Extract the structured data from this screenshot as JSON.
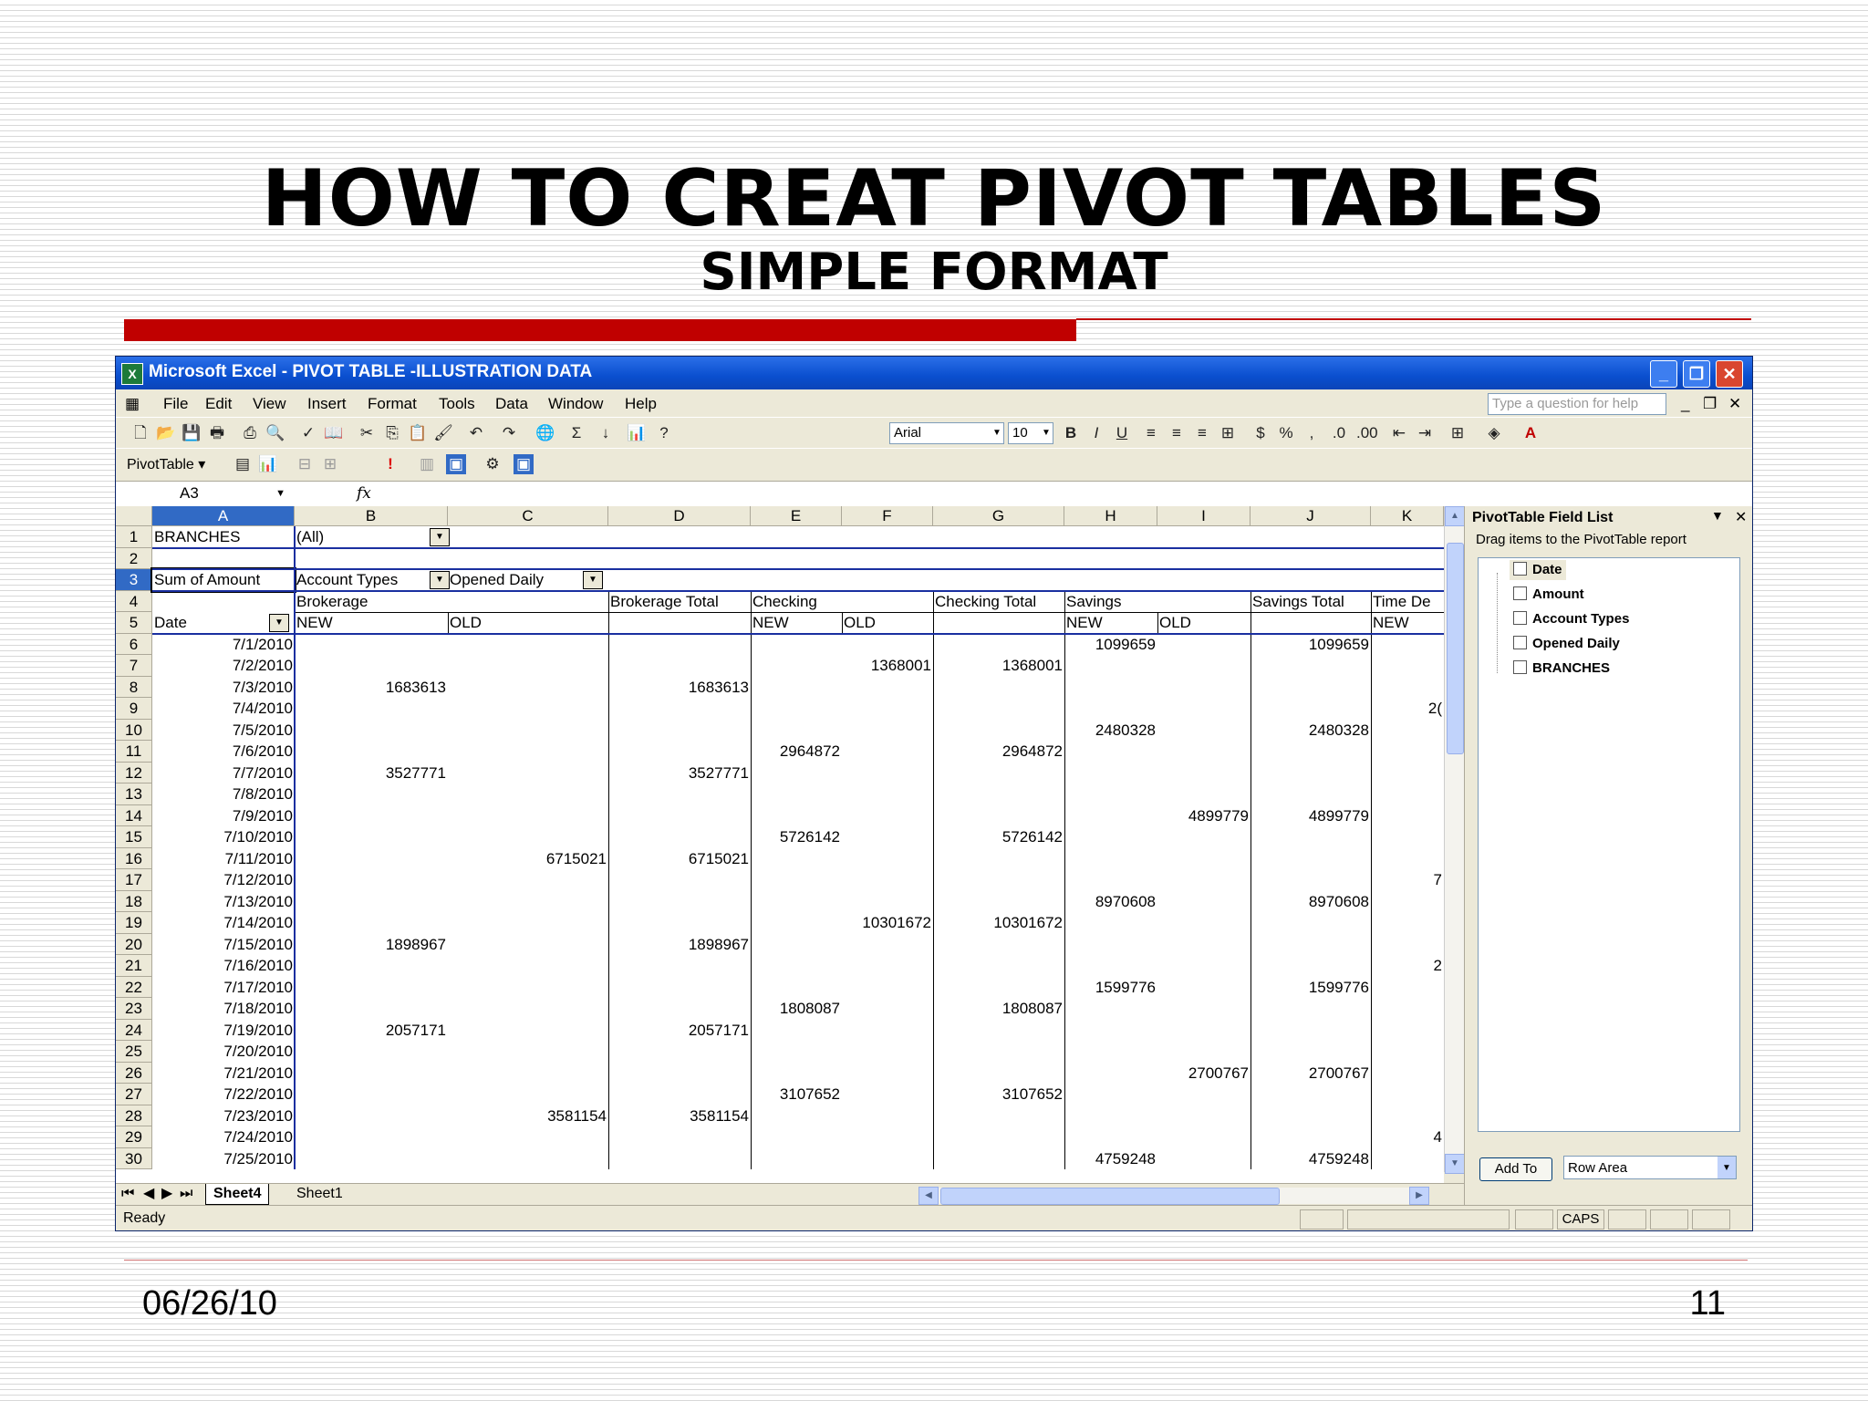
{
  "slide": {
    "title": "HOW TO CREAT PIVOT TABLES",
    "subtitle": "SIMPLE FORMAT",
    "date": "06/26/10",
    "page_number": "11"
  },
  "window": {
    "title": "Microsoft Excel - PIVOT TABLE -ILLUSTRATION DATA",
    "menu": [
      "File",
      "Edit",
      "View",
      "Insert",
      "Format",
      "Tools",
      "Data",
      "Window",
      "Help"
    ],
    "ask_placeholder": "Type a question for help",
    "font_name": "Arial",
    "font_size": "10",
    "pivot_toolbar_label": "PivotTable ▾",
    "name_box": "A3",
    "fx": "fx"
  },
  "grid": {
    "columns": [
      "A",
      "B",
      "C",
      "D",
      "E",
      "F",
      "G",
      "H",
      "I",
      "J",
      "K"
    ],
    "rows": [
      "1",
      "2",
      "3",
      "4",
      "5",
      "6",
      "7",
      "8",
      "9",
      "10",
      "11",
      "12",
      "13",
      "14",
      "15",
      "16",
      "17",
      "18",
      "19",
      "20",
      "21",
      "22",
      "23",
      "24",
      "25",
      "26",
      "27",
      "28",
      "29",
      "30"
    ],
    "header": {
      "branches_label": "BRANCHES",
      "branches_value": "(All)",
      "sum_label": "Sum of Amount",
      "account_types": "Account Types",
      "opened_daily": "Opened Daily",
      "brokerage": "Brokerage",
      "brokerage_total": "Brokerage Total",
      "checking": "Checking",
      "checking_total": "Checking Total",
      "savings": "Savings",
      "savings_total": "Savings Total",
      "time_de": "Time De",
      "date": "Date",
      "new": "NEW",
      "old": "OLD"
    },
    "data_rows": [
      {
        "date": "7/1/2010",
        "b": "",
        "c": "",
        "d": "",
        "e": "",
        "f": "",
        "g": "",
        "h": "1099659",
        "i": "",
        "j": "1099659",
        "k": ""
      },
      {
        "date": "7/2/2010",
        "b": "",
        "c": "",
        "d": "",
        "e": "",
        "f": "1368001",
        "g": "1368001",
        "h": "",
        "i": "",
        "j": "",
        "k": ""
      },
      {
        "date": "7/3/2010",
        "b": "1683613",
        "c": "",
        "d": "1683613",
        "e": "",
        "f": "",
        "g": "",
        "h": "",
        "i": "",
        "j": "",
        "k": ""
      },
      {
        "date": "7/4/2010",
        "b": "",
        "c": "",
        "d": "",
        "e": "",
        "f": "",
        "g": "",
        "h": "",
        "i": "",
        "j": "",
        "k": "2("
      },
      {
        "date": "7/5/2010",
        "b": "",
        "c": "",
        "d": "",
        "e": "",
        "f": "",
        "g": "",
        "h": "2480328",
        "i": "",
        "j": "2480328",
        "k": ""
      },
      {
        "date": "7/6/2010",
        "b": "",
        "c": "",
        "d": "",
        "e": "2964872",
        "f": "",
        "g": "2964872",
        "h": "",
        "i": "",
        "j": "",
        "k": ""
      },
      {
        "date": "7/7/2010",
        "b": "3527771",
        "c": "",
        "d": "3527771",
        "e": "",
        "f": "",
        "g": "",
        "h": "",
        "i": "",
        "j": "",
        "k": ""
      },
      {
        "date": "7/8/2010",
        "b": "",
        "c": "",
        "d": "",
        "e": "",
        "f": "",
        "g": "",
        "h": "",
        "i": "",
        "j": "",
        "k": ""
      },
      {
        "date": "7/9/2010",
        "b": "",
        "c": "",
        "d": "",
        "e": "",
        "f": "",
        "g": "",
        "h": "",
        "i": "4899779",
        "j": "4899779",
        "k": ""
      },
      {
        "date": "7/10/2010",
        "b": "",
        "c": "",
        "d": "",
        "e": "5726142",
        "f": "",
        "g": "5726142",
        "h": "",
        "i": "",
        "j": "",
        "k": ""
      },
      {
        "date": "7/11/2010",
        "b": "",
        "c": "6715021",
        "d": "6715021",
        "e": "",
        "f": "",
        "g": "",
        "h": "",
        "i": "",
        "j": "",
        "k": ""
      },
      {
        "date": "7/12/2010",
        "b": "",
        "c": "",
        "d": "",
        "e": "",
        "f": "",
        "g": "",
        "h": "",
        "i": "",
        "j": "",
        "k": "7"
      },
      {
        "date": "7/13/2010",
        "b": "",
        "c": "",
        "d": "",
        "e": "",
        "f": "",
        "g": "",
        "h": "8970608",
        "i": "",
        "j": "8970608",
        "k": ""
      },
      {
        "date": "7/14/2010",
        "b": "",
        "c": "",
        "d": "",
        "e": "",
        "f": "10301672",
        "g": "10301672",
        "h": "",
        "i": "",
        "j": "",
        "k": ""
      },
      {
        "date": "7/15/2010",
        "b": "1898967",
        "c": "",
        "d": "1898967",
        "e": "",
        "f": "",
        "g": "",
        "h": "",
        "i": "",
        "j": "",
        "k": ""
      },
      {
        "date": "7/16/2010",
        "b": "",
        "c": "",
        "d": "",
        "e": "",
        "f": "",
        "g": "",
        "h": "",
        "i": "",
        "j": "",
        "k": "2"
      },
      {
        "date": "7/17/2010",
        "b": "",
        "c": "",
        "d": "",
        "e": "",
        "f": "",
        "g": "",
        "h": "1599776",
        "i": "",
        "j": "1599776",
        "k": ""
      },
      {
        "date": "7/18/2010",
        "b": "",
        "c": "",
        "d": "",
        "e": "1808087",
        "f": "",
        "g": "1808087",
        "h": "",
        "i": "",
        "j": "",
        "k": ""
      },
      {
        "date": "7/19/2010",
        "b": "2057171",
        "c": "",
        "d": "2057171",
        "e": "",
        "f": "",
        "g": "",
        "h": "",
        "i": "",
        "j": "",
        "k": ""
      },
      {
        "date": "7/20/2010",
        "b": "",
        "c": "",
        "d": "",
        "e": "",
        "f": "",
        "g": "",
        "h": "",
        "i": "",
        "j": "",
        "k": ""
      },
      {
        "date": "7/21/2010",
        "b": "",
        "c": "",
        "d": "",
        "e": "",
        "f": "",
        "g": "",
        "h": "",
        "i": "2700767",
        "j": "2700767",
        "k": ""
      },
      {
        "date": "7/22/2010",
        "b": "",
        "c": "",
        "d": "",
        "e": "3107652",
        "f": "",
        "g": "3107652",
        "h": "",
        "i": "",
        "j": "",
        "k": ""
      },
      {
        "date": "7/23/2010",
        "b": "",
        "c": "3581154",
        "d": "3581154",
        "e": "",
        "f": "",
        "g": "",
        "h": "",
        "i": "",
        "j": "",
        "k": ""
      },
      {
        "date": "7/24/2010",
        "b": "",
        "c": "",
        "d": "",
        "e": "",
        "f": "",
        "g": "",
        "h": "",
        "i": "",
        "j": "",
        "k": "4"
      },
      {
        "date": "7/25/2010",
        "b": "",
        "c": "",
        "d": "",
        "e": "",
        "f": "",
        "g": "",
        "h": "4759248",
        "i": "",
        "j": "4759248",
        "k": ""
      }
    ]
  },
  "sheets": [
    "Sheet4",
    "Sheet1"
  ],
  "status": {
    "ready": "Ready",
    "caps": "CAPS"
  },
  "pivot_pane": {
    "title": "PivotTable Field List",
    "hint": "Drag items to the PivotTable report",
    "fields": [
      "Date",
      "Amount",
      "Account Types",
      "Opened Daily",
      "BRANCHES"
    ],
    "add_button": "Add To",
    "area": "Row Area"
  },
  "colors": {
    "accent_red": "#c00000",
    "selection_blue": "#316ac5",
    "title_blue": "#0a4fcf"
  }
}
